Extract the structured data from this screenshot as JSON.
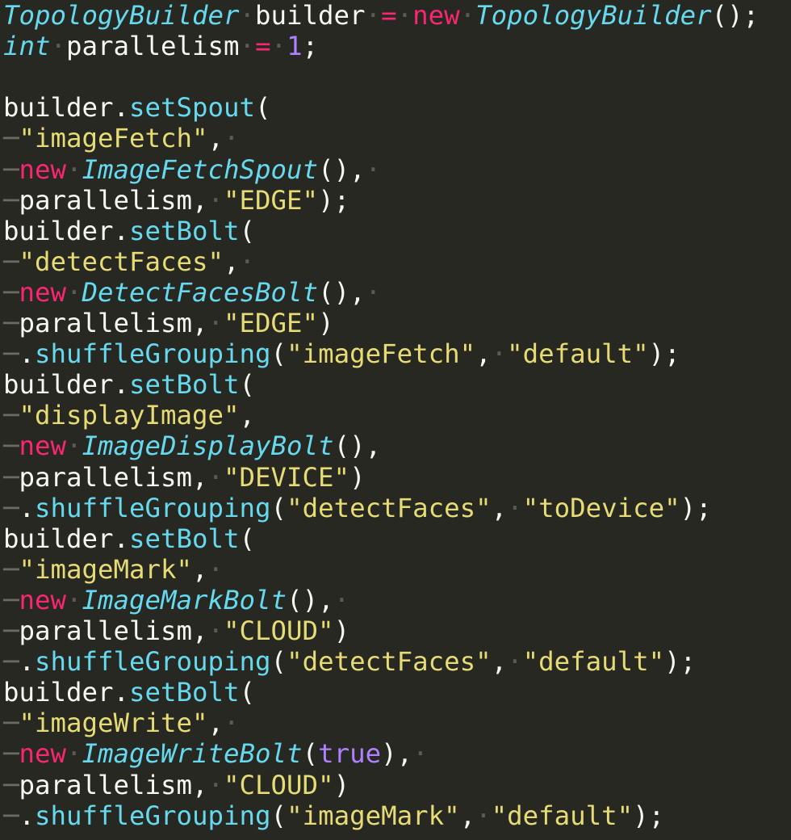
{
  "editor": {
    "background": "#272822",
    "colors": {
      "type": "#66d9ef",
      "keyword": "#f92672",
      "class": "#66d9ef",
      "string": "#e6db74",
      "number": "#ae81ff",
      "function": "#66d9ef",
      "plain": "#f8f8f2",
      "whitespace": "#5c5c55"
    },
    "lines": [
      [
        [
          "type",
          "TopologyBuilder"
        ],
        [
          "ws",
          "·"
        ],
        [
          "plain",
          "builder"
        ],
        [
          "ws",
          "·"
        ],
        [
          "op",
          "="
        ],
        [
          "ws",
          "·"
        ],
        [
          "kw",
          "new"
        ],
        [
          "ws",
          "·"
        ],
        [
          "cls",
          "TopologyBuilder"
        ],
        [
          "plain",
          "();"
        ]
      ],
      [
        [
          "type",
          "int"
        ],
        [
          "ws",
          "·"
        ],
        [
          "plain",
          "parallelism"
        ],
        [
          "ws",
          "·"
        ],
        [
          "op",
          "="
        ],
        [
          "ws",
          "·"
        ],
        [
          "num",
          "1"
        ],
        [
          "plain",
          ";"
        ]
      ],
      [],
      [
        [
          "plain",
          "builder."
        ],
        [
          "fn",
          "setSpout"
        ],
        [
          "plain",
          "("
        ]
      ],
      [
        [
          "indent",
          "─"
        ],
        [
          "str",
          "\"imageFetch\""
        ],
        [
          "plain",
          ","
        ],
        [
          "ws",
          "·"
        ]
      ],
      [
        [
          "indent",
          "─"
        ],
        [
          "kw",
          "new"
        ],
        [
          "ws",
          "·"
        ],
        [
          "cls",
          "ImageFetchSpout"
        ],
        [
          "plain",
          "(),"
        ],
        [
          "ws",
          "·"
        ]
      ],
      [
        [
          "indent",
          "─"
        ],
        [
          "plain",
          "parallelism,"
        ],
        [
          "ws",
          "·"
        ],
        [
          "str",
          "\"EDGE\""
        ],
        [
          "plain",
          ");"
        ]
      ],
      [
        [
          "plain",
          "builder."
        ],
        [
          "fn",
          "setBolt"
        ],
        [
          "plain",
          "("
        ]
      ],
      [
        [
          "indent",
          "─"
        ],
        [
          "str",
          "\"detectFaces\""
        ],
        [
          "plain",
          ","
        ],
        [
          "ws",
          "·"
        ]
      ],
      [
        [
          "indent",
          "─"
        ],
        [
          "kw",
          "new"
        ],
        [
          "ws",
          "·"
        ],
        [
          "cls",
          "DetectFacesBolt"
        ],
        [
          "plain",
          "(),"
        ],
        [
          "ws",
          "·"
        ]
      ],
      [
        [
          "indent",
          "─"
        ],
        [
          "plain",
          "parallelism,"
        ],
        [
          "ws",
          "·"
        ],
        [
          "str",
          "\"EDGE\""
        ],
        [
          "plain",
          ")"
        ]
      ],
      [
        [
          "indent",
          "─"
        ],
        [
          "plain",
          "."
        ],
        [
          "fn",
          "shuffleGrouping"
        ],
        [
          "plain",
          "("
        ],
        [
          "str",
          "\"imageFetch\""
        ],
        [
          "plain",
          ","
        ],
        [
          "ws",
          "·"
        ],
        [
          "str",
          "\"default\""
        ],
        [
          "plain",
          ");"
        ]
      ],
      [
        [
          "plain",
          "builder."
        ],
        [
          "fn",
          "setBolt"
        ],
        [
          "plain",
          "("
        ]
      ],
      [
        [
          "indent",
          "─"
        ],
        [
          "str",
          "\"displayImage\""
        ],
        [
          "plain",
          ","
        ]
      ],
      [
        [
          "indent",
          "─"
        ],
        [
          "kw",
          "new"
        ],
        [
          "ws",
          "·"
        ],
        [
          "cls",
          "ImageDisplayBolt"
        ],
        [
          "plain",
          "(),"
        ]
      ],
      [
        [
          "indent",
          "─"
        ],
        [
          "plain",
          "parallelism,"
        ],
        [
          "ws",
          "·"
        ],
        [
          "str",
          "\"DEVICE\""
        ],
        [
          "plain",
          ")"
        ]
      ],
      [
        [
          "indent",
          "─"
        ],
        [
          "plain",
          "."
        ],
        [
          "fn",
          "shuffleGrouping"
        ],
        [
          "plain",
          "("
        ],
        [
          "str",
          "\"detectFaces\""
        ],
        [
          "plain",
          ","
        ],
        [
          "ws",
          "·"
        ],
        [
          "str",
          "\"toDevice\""
        ],
        [
          "plain",
          ");"
        ]
      ],
      [
        [
          "plain",
          "builder."
        ],
        [
          "fn",
          "setBolt"
        ],
        [
          "plain",
          "("
        ]
      ],
      [
        [
          "indent",
          "─"
        ],
        [
          "str",
          "\"imageMark\""
        ],
        [
          "plain",
          ","
        ],
        [
          "ws",
          "·"
        ]
      ],
      [
        [
          "indent",
          "─"
        ],
        [
          "kw",
          "new"
        ],
        [
          "ws",
          "·"
        ],
        [
          "cls",
          "ImageMarkBolt"
        ],
        [
          "plain",
          "(),"
        ],
        [
          "ws",
          "·"
        ]
      ],
      [
        [
          "indent",
          "─"
        ],
        [
          "plain",
          "parallelism,"
        ],
        [
          "ws",
          "·"
        ],
        [
          "str",
          "\"CLOUD\""
        ],
        [
          "plain",
          ")"
        ]
      ],
      [
        [
          "indent",
          "─"
        ],
        [
          "plain",
          "."
        ],
        [
          "fn",
          "shuffleGrouping"
        ],
        [
          "plain",
          "("
        ],
        [
          "str",
          "\"detectFaces\""
        ],
        [
          "plain",
          ","
        ],
        [
          "ws",
          "·"
        ],
        [
          "str",
          "\"default\""
        ],
        [
          "plain",
          ");"
        ]
      ],
      [
        [
          "plain",
          "builder."
        ],
        [
          "fn",
          "setBolt"
        ],
        [
          "plain",
          "("
        ]
      ],
      [
        [
          "indent",
          "─"
        ],
        [
          "str",
          "\"imageWrite\""
        ],
        [
          "plain",
          ","
        ],
        [
          "ws",
          "·"
        ]
      ],
      [
        [
          "indent",
          "─"
        ],
        [
          "kw",
          "new"
        ],
        [
          "ws",
          "·"
        ],
        [
          "cls",
          "ImageWriteBolt"
        ],
        [
          "plain",
          "("
        ],
        [
          "bool",
          "true"
        ],
        [
          "plain",
          "),"
        ],
        [
          "ws",
          "·"
        ]
      ],
      [
        [
          "indent",
          "─"
        ],
        [
          "plain",
          "parallelism,"
        ],
        [
          "ws",
          "·"
        ],
        [
          "str",
          "\"CLOUD\""
        ],
        [
          "plain",
          ")"
        ]
      ],
      [
        [
          "indent",
          "─"
        ],
        [
          "plain",
          "."
        ],
        [
          "fn",
          "shuffleGrouping"
        ],
        [
          "plain",
          "("
        ],
        [
          "str",
          "\"imageMark\""
        ],
        [
          "plain",
          ","
        ],
        [
          "ws",
          "·"
        ],
        [
          "str",
          "\"default\""
        ],
        [
          "plain",
          ");"
        ]
      ]
    ]
  }
}
